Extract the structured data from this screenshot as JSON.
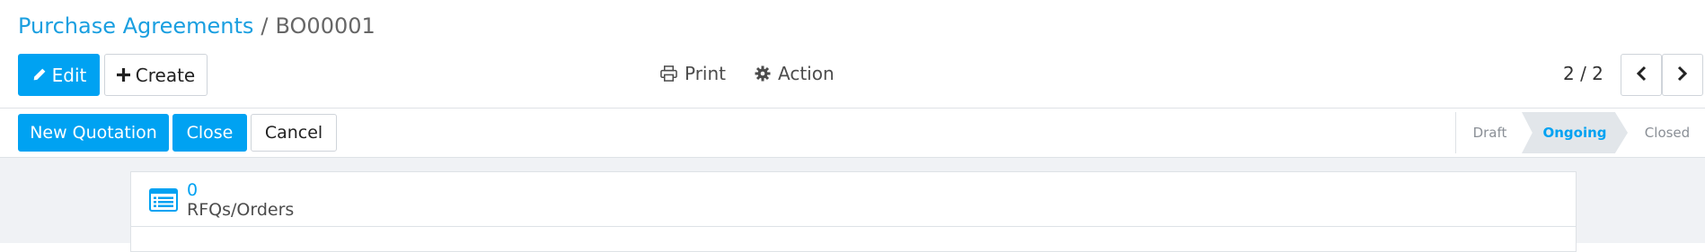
{
  "breadcrumb": {
    "parent": "Purchase Agreements",
    "separator": "/",
    "current": "BO00001"
  },
  "toolbar": {
    "edit_label": "Edit",
    "create_label": "Create",
    "print_label": "Print",
    "action_label": "Action",
    "edit_icon": "pencil-icon",
    "create_icon": "plus-icon",
    "print_icon": "printer-icon",
    "action_icon": "gear-icon"
  },
  "pager": {
    "value": "2 / 2"
  },
  "statusbar": {
    "buttons": {
      "new_quotation": "New Quotation",
      "close": "Close",
      "cancel": "Cancel"
    },
    "stages": [
      "Draft",
      "Ongoing",
      "Closed"
    ],
    "active_stage": "Ongoing"
  },
  "smart_button": {
    "value": "0",
    "label": "RFQs/Orders",
    "icon": "list-icon"
  },
  "colors": {
    "primary": "#00A2F2",
    "breadcrumb_link": "#1a9fe0",
    "background": "#f0f2f5"
  }
}
